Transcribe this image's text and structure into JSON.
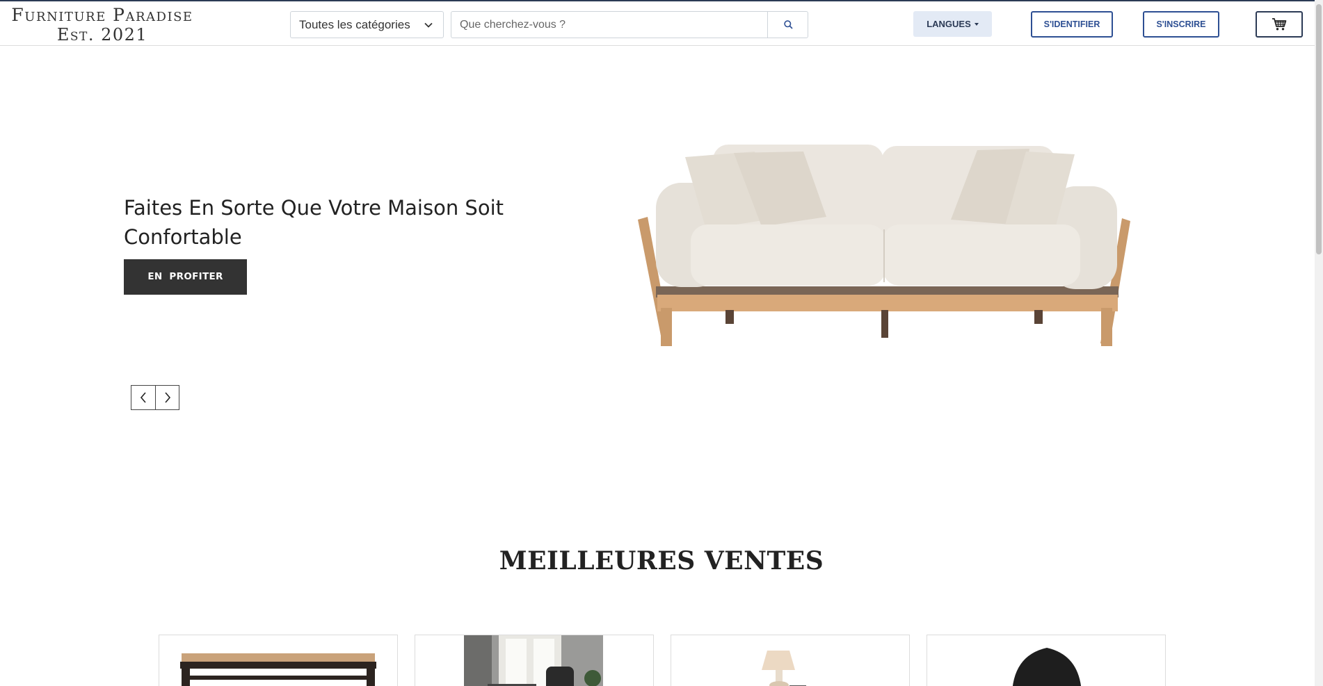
{
  "header": {
    "logo_line1": "Furniture Paradise",
    "logo_line2": "Est. 2021",
    "category_select_value": "Toutes les catégories",
    "search_placeholder": "Que cherchez-vous ?",
    "languages_label": "LANGUES",
    "login_label": "S'IDENTIFIER",
    "signup_label": "S'INSCRIRE",
    "icons": [
      "chevron-down-icon",
      "search-icon",
      "cart-icon"
    ]
  },
  "hero": {
    "title": "Faites En Sorte Que Votre Maison Soit Confortable",
    "cta_label": "EN  PROFITER",
    "image": "sofa-image",
    "icons": [
      "chevron-left-icon",
      "chevron-right-icon"
    ]
  },
  "best_sellers": {
    "title": "MEILLEURES VENTES",
    "products": [
      {
        "image": "table-image"
      },
      {
        "image": "office-chair-room-image"
      },
      {
        "image": "bedside-lamp-table-image"
      },
      {
        "image": "black-chair-image"
      }
    ]
  },
  "colors": {
    "accent": "#2d4f93",
    "dark_button": "#333333",
    "languages_bg": "#e3eaf5"
  }
}
